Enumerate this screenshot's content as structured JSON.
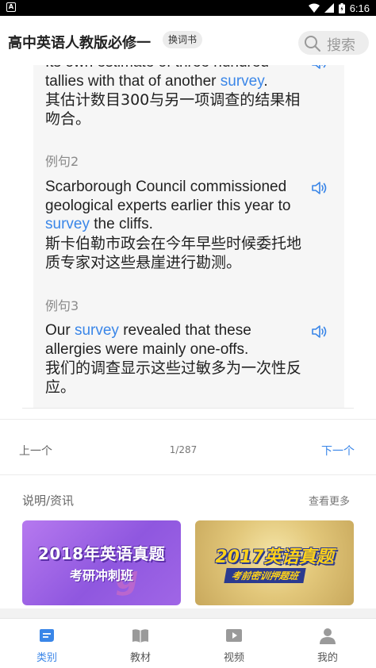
{
  "status_bar": {
    "app_badge": "A",
    "time": "6:16"
  },
  "header": {
    "book_title": "高中英语人教版必修一",
    "switch_label": "换词书",
    "search_placeholder": "搜索"
  },
  "examples": [
    {
      "label": "",
      "en_parts": [
        "Its own estimate of three hundred tallies with that of another ",
        "survey",
        "."
      ],
      "zh": "其估计数目300与另一项调查的结果相吻合。"
    },
    {
      "label": "例句2",
      "en_parts": [
        "Scarborough Council commissioned geological experts earlier this year to ",
        "survey",
        " the cliffs."
      ],
      "zh": "斯卡伯勒市政会在今年早些时候委托地质专家对这些悬崖进行勘测。"
    },
    {
      "label": "例句3",
      "en_parts": [
        "Our ",
        "survey",
        " revealed that these allergies were mainly one-offs."
      ],
      "zh": "我们的调查显示这些过敏多为一次性反应。"
    }
  ],
  "pagination": {
    "prev": "上一个",
    "page": "1/287",
    "next": "下一个"
  },
  "news": {
    "title": "说明/资讯",
    "more": "查看更多",
    "banners": [
      {
        "main": "2018年英语真题",
        "sub": "考研冲刺班"
      },
      {
        "main": "2017英语真题",
        "sub": "考前密训押题班"
      }
    ]
  },
  "bottom_nav": [
    {
      "label": "类别",
      "icon": "category-icon",
      "active": true
    },
    {
      "label": "教材",
      "icon": "book-icon",
      "active": false
    },
    {
      "label": "视频",
      "icon": "video-icon",
      "active": false
    },
    {
      "label": "我的",
      "icon": "profile-icon",
      "active": false
    }
  ],
  "colors": {
    "accent": "#3a86e8",
    "card_bg": "#f6f6f6",
    "muted": "#8a8a8a"
  }
}
